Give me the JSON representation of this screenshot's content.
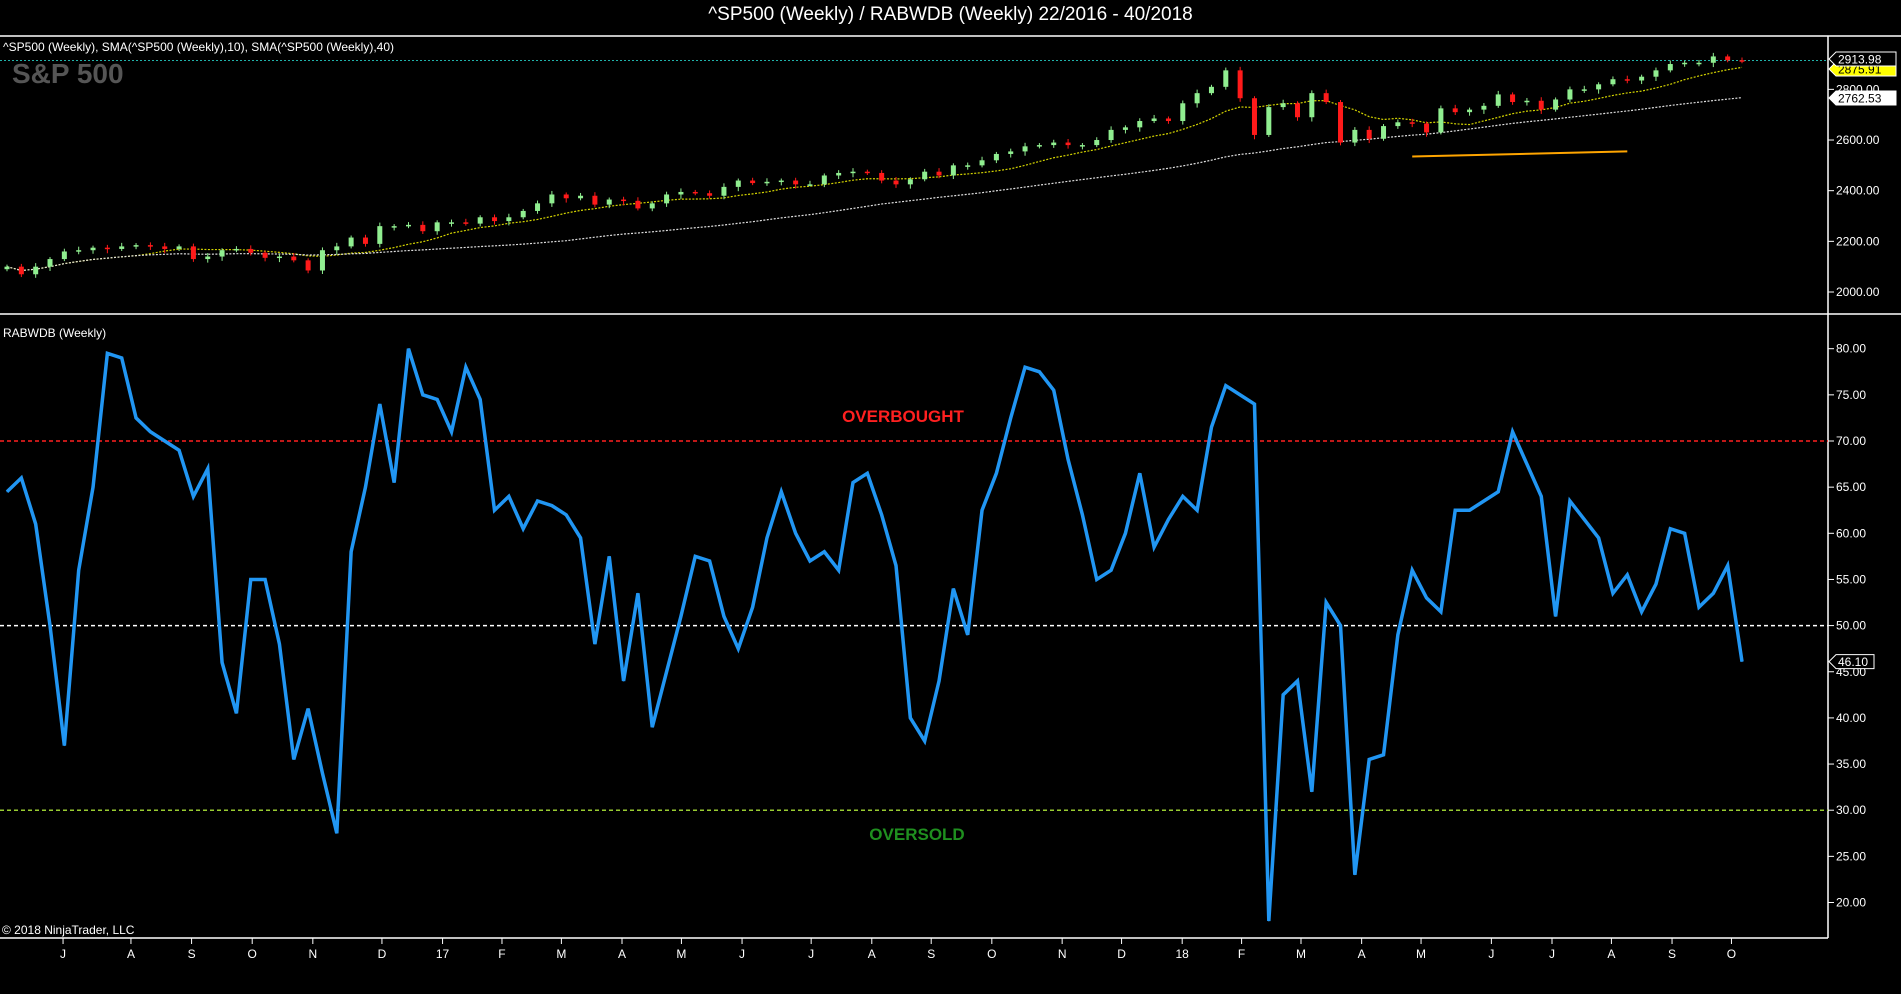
{
  "chart_data": [
    {
      "type": "candlestick",
      "title": "^SP500 (Weekly) / RABWDB (Weekly)  22/2016 - 40/2018",
      "panel_label": "^SP500 (Weekly),  SMA(^SP500 (Weekly),10),  SMA(^SP500 (Weekly),40)",
      "watermark": "S&P 500",
      "ylim": [
        1950,
        2950
      ],
      "yticks": [
        "2000.00",
        "2200.00",
        "2400.00",
        "2600.00",
        "2800.00"
      ],
      "last_price_label": "2913.98",
      "last_price": 2913.98,
      "sma10_label": "2875.91",
      "sma40_label": "2762.53",
      "support_line": {
        "from_week": 98,
        "to_week": 113,
        "from_value": 2535,
        "to_value": 2555
      },
      "closes": [
        2100,
        2070,
        2100,
        2130,
        2160,
        2165,
        2175,
        2170,
        2180,
        2185,
        2180,
        2170,
        2180,
        2130,
        2140,
        2165,
        2170,
        2155,
        2135,
        2140,
        2125,
        2085,
        2165,
        2180,
        2215,
        2190,
        2260,
        2260,
        2265,
        2240,
        2275,
        2275,
        2270,
        2295,
        2280,
        2295,
        2320,
        2350,
        2385,
        2370,
        2380,
        2345,
        2365,
        2360,
        2330,
        2350,
        2385,
        2395,
        2390,
        2380,
        2415,
        2440,
        2430,
        2435,
        2440,
        2425,
        2425,
        2460,
        2470,
        2475,
        2470,
        2440,
        2425,
        2445,
        2475,
        2460,
        2500,
        2500,
        2520,
        2545,
        2555,
        2575,
        2580,
        2590,
        2580,
        2580,
        2600,
        2640,
        2650,
        2675,
        2685,
        2675,
        2745,
        2785,
        2810,
        2875,
        2765,
        2620,
        2730,
        2745,
        2690,
        2785,
        2750,
        2590,
        2640,
        2605,
        2655,
        2670,
        2665,
        2630,
        2725,
        2710,
        2720,
        2735,
        2780,
        2750,
        2755,
        2720,
        2760,
        2800,
        2800,
        2820,
        2840,
        2835,
        2850,
        2875,
        2900,
        2905,
        2905,
        2930,
        2915,
        2914
      ]
    },
    {
      "type": "line",
      "panel_label": "RABWDB (Weekly)",
      "ylim": [
        15,
        83
      ],
      "yticks": [
        "20.00",
        "25.00",
        "30.00",
        "35.00",
        "40.00",
        "45.00",
        "50.00",
        "55.00",
        "60.00",
        "65.00",
        "70.00",
        "75.00",
        "80.00"
      ],
      "overbought": {
        "value": 70,
        "label": "OVERBOUGHT",
        "color": "#ff2020"
      },
      "midline": {
        "value": 50,
        "color": "#ffffff"
      },
      "oversold": {
        "value": 30,
        "label": "OVERSOLD",
        "color": "#9acd32"
      },
      "last_value_label": "46.10",
      "series_color": "#2196f3",
      "values": [
        64.5,
        66,
        61,
        50,
        37,
        56,
        65,
        79.5,
        79,
        72.5,
        71,
        70,
        69,
        64,
        67,
        46,
        40.5,
        55,
        55,
        48,
        35.5,
        41,
        34,
        27.5,
        58,
        65,
        74,
        65.5,
        80,
        75,
        74.5,
        71,
        78,
        74.5,
        62.5,
        64,
        60.5,
        63.5,
        63,
        62,
        59.5,
        48,
        57.5,
        44,
        53.5,
        39,
        45,
        51,
        57.5,
        57,
        51,
        47.5,
        52,
        59.5,
        64.5,
        60,
        57,
        58,
        56,
        65.5,
        66.5,
        62,
        56.5,
        40,
        37.5,
        44,
        54,
        49,
        62.5,
        66.5,
        72.5,
        78,
        77.5,
        75.5,
        68,
        62,
        55,
        56,
        60,
        66.5,
        58.5,
        61.5,
        64,
        62.5,
        71.5,
        76,
        75,
        74,
        18,
        42.5,
        44,
        32,
        52.5,
        50,
        23,
        35.5,
        36,
        49,
        56,
        53,
        51.5,
        62.5,
        62.5,
        63.5,
        64.5,
        71,
        67.5,
        64,
        51,
        63.5,
        61.5,
        59.5,
        53.5,
        55.5,
        51.5,
        54.5,
        60.5,
        60,
        52,
        53.5,
        56.5,
        46.1
      ]
    }
  ],
  "x_axis": {
    "labels": [
      "J",
      "A",
      "S",
      "O",
      "N",
      "D",
      "17",
      "F",
      "M",
      "A",
      "M",
      "J",
      "J",
      "A",
      "S",
      "O",
      "N",
      "D",
      "18",
      "F",
      "M",
      "A",
      "M",
      "J",
      "J",
      "A",
      "S",
      "O"
    ]
  },
  "footer": {
    "copyright": "© 2018 NinjaTrader, LLC"
  },
  "colors": {
    "up": "#90ee90",
    "down": "#ff1a1a",
    "sma10": "#d4d400",
    "sma40": "#e0e0e0",
    "support": "#ffa500",
    "last_line": "#20b2aa"
  }
}
